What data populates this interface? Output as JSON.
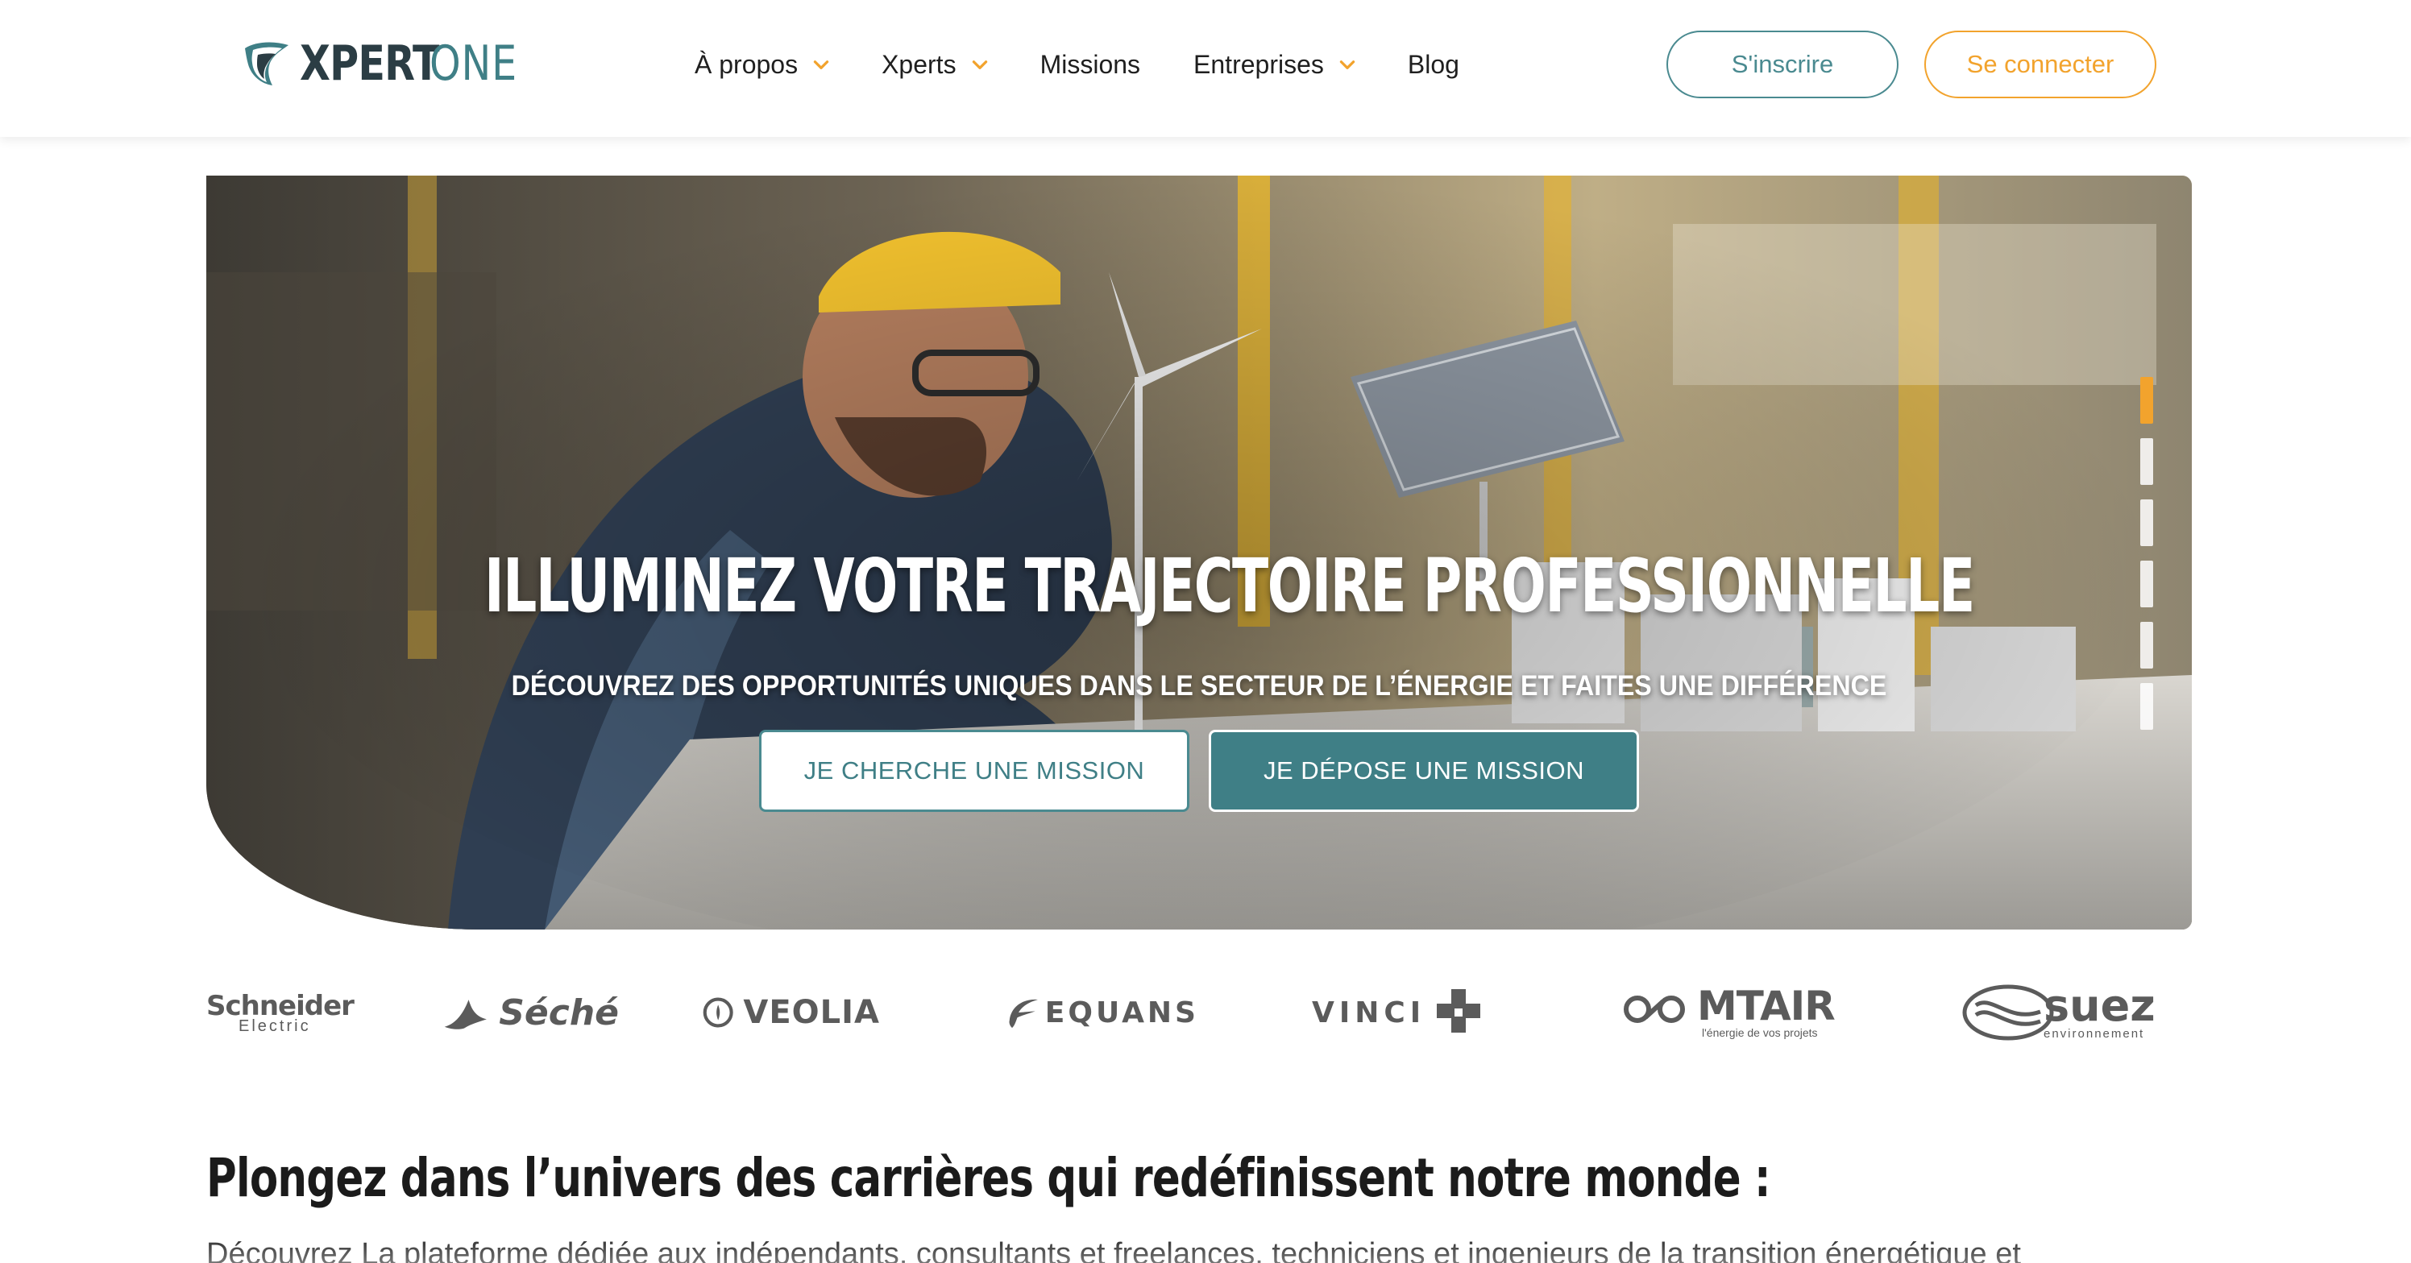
{
  "header": {
    "logo": {
      "part1": "XPERT",
      "part2": "ONE"
    },
    "nav": [
      {
        "label": "À propos",
        "dropdown": true
      },
      {
        "label": "Xperts",
        "dropdown": true
      },
      {
        "label": "Missions",
        "dropdown": false
      },
      {
        "label": "Entreprises",
        "dropdown": true
      },
      {
        "label": "Blog",
        "dropdown": false
      }
    ],
    "signup_label": "S'inscrire",
    "login_label": "Se connecter"
  },
  "hero": {
    "title": "ILLUMINEZ VOTRE TRAJECTOIRE PROFESSIONNELLE",
    "subtitle": "DÉCOUVREZ DES OPPORTUNITÉS UNIQUES DANS LE SECTEUR DE L’ÉNERGIE ET FAITES UNE DIFFÉRENCE",
    "button_search": "JE CHERCHE UNE MISSION",
    "button_post": "JE DÉPOSE UNE MISSION",
    "slides": 6,
    "active_slide": 1
  },
  "partners": {
    "schneider": {
      "line1": "Schneider",
      "line2": "Electric"
    },
    "seche": "Séché",
    "veolia": "VEOLIA",
    "equans": "EQUANS",
    "vinci": "VINCI",
    "mtair": {
      "name": "MTAIR",
      "tagline": "l'énergie de vos projets"
    },
    "suez": {
      "name": "suez",
      "tagline": "environnement"
    }
  },
  "section": {
    "title": "Plongez dans l’univers des carrières qui redéfinissent notre monde :",
    "text": "Découvrez La plateforme dédiée aux indépendants, consultants et freelances, techniciens et ingenieurs de la transition énergétique et"
  },
  "colors": {
    "teal": "#3f7f86",
    "orange": "#f2a32d",
    "dark": "#2b3d44"
  }
}
